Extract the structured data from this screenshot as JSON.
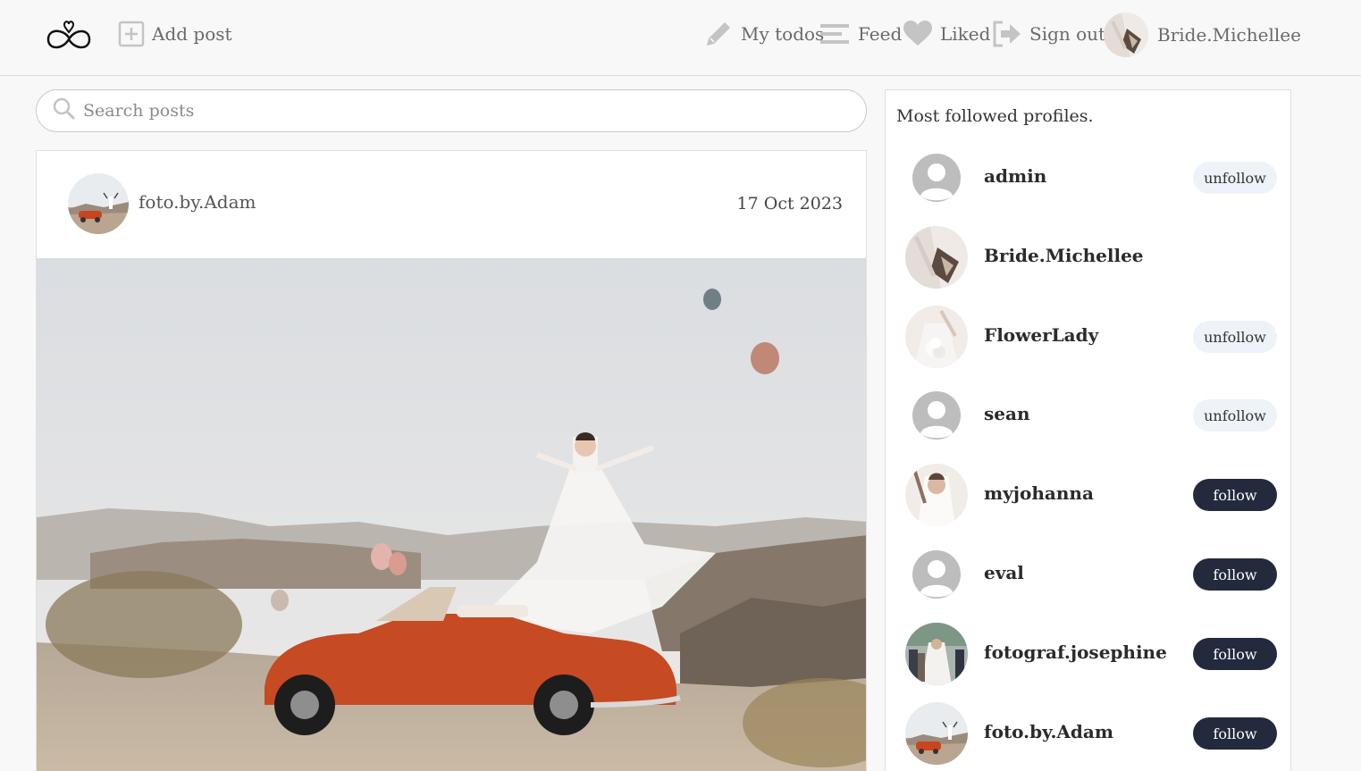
{
  "nav": {
    "add_post": "Add post",
    "my_todos": "My todos",
    "feed": "Feed",
    "liked": "Liked",
    "sign_out": "Sign out",
    "user": "Bride.Michellee"
  },
  "search": {
    "placeholder": "Search posts"
  },
  "post": {
    "author": "foto.by.Adam",
    "date": "17 Oct 2023"
  },
  "sidebar": {
    "title": "Most followed profiles.",
    "profiles": [
      {
        "name": "admin",
        "action": "unfollow",
        "avatar": "default-avatar"
      },
      {
        "name": "Bride.Michellee",
        "action": "",
        "avatar": "photo-avatar"
      },
      {
        "name": "FlowerLady",
        "action": "unfollow",
        "avatar": "photo-avatar"
      },
      {
        "name": "sean",
        "action": "unfollow",
        "avatar": "default-avatar"
      },
      {
        "name": "myjohanna",
        "action": "follow",
        "avatar": "photo-avatar"
      },
      {
        "name": "eval",
        "action": "follow",
        "avatar": "default-avatar"
      },
      {
        "name": "fotograf.josephine",
        "action": "follow",
        "avatar": "photo-avatar"
      },
      {
        "name": "foto.by.Adam",
        "action": "follow",
        "avatar": "photo-avatar"
      }
    ]
  },
  "colors": {
    "follow_bg": "#232a3d",
    "unfollow_bg": "#eef3fa",
    "icon_gray": "#c4c4c4"
  }
}
